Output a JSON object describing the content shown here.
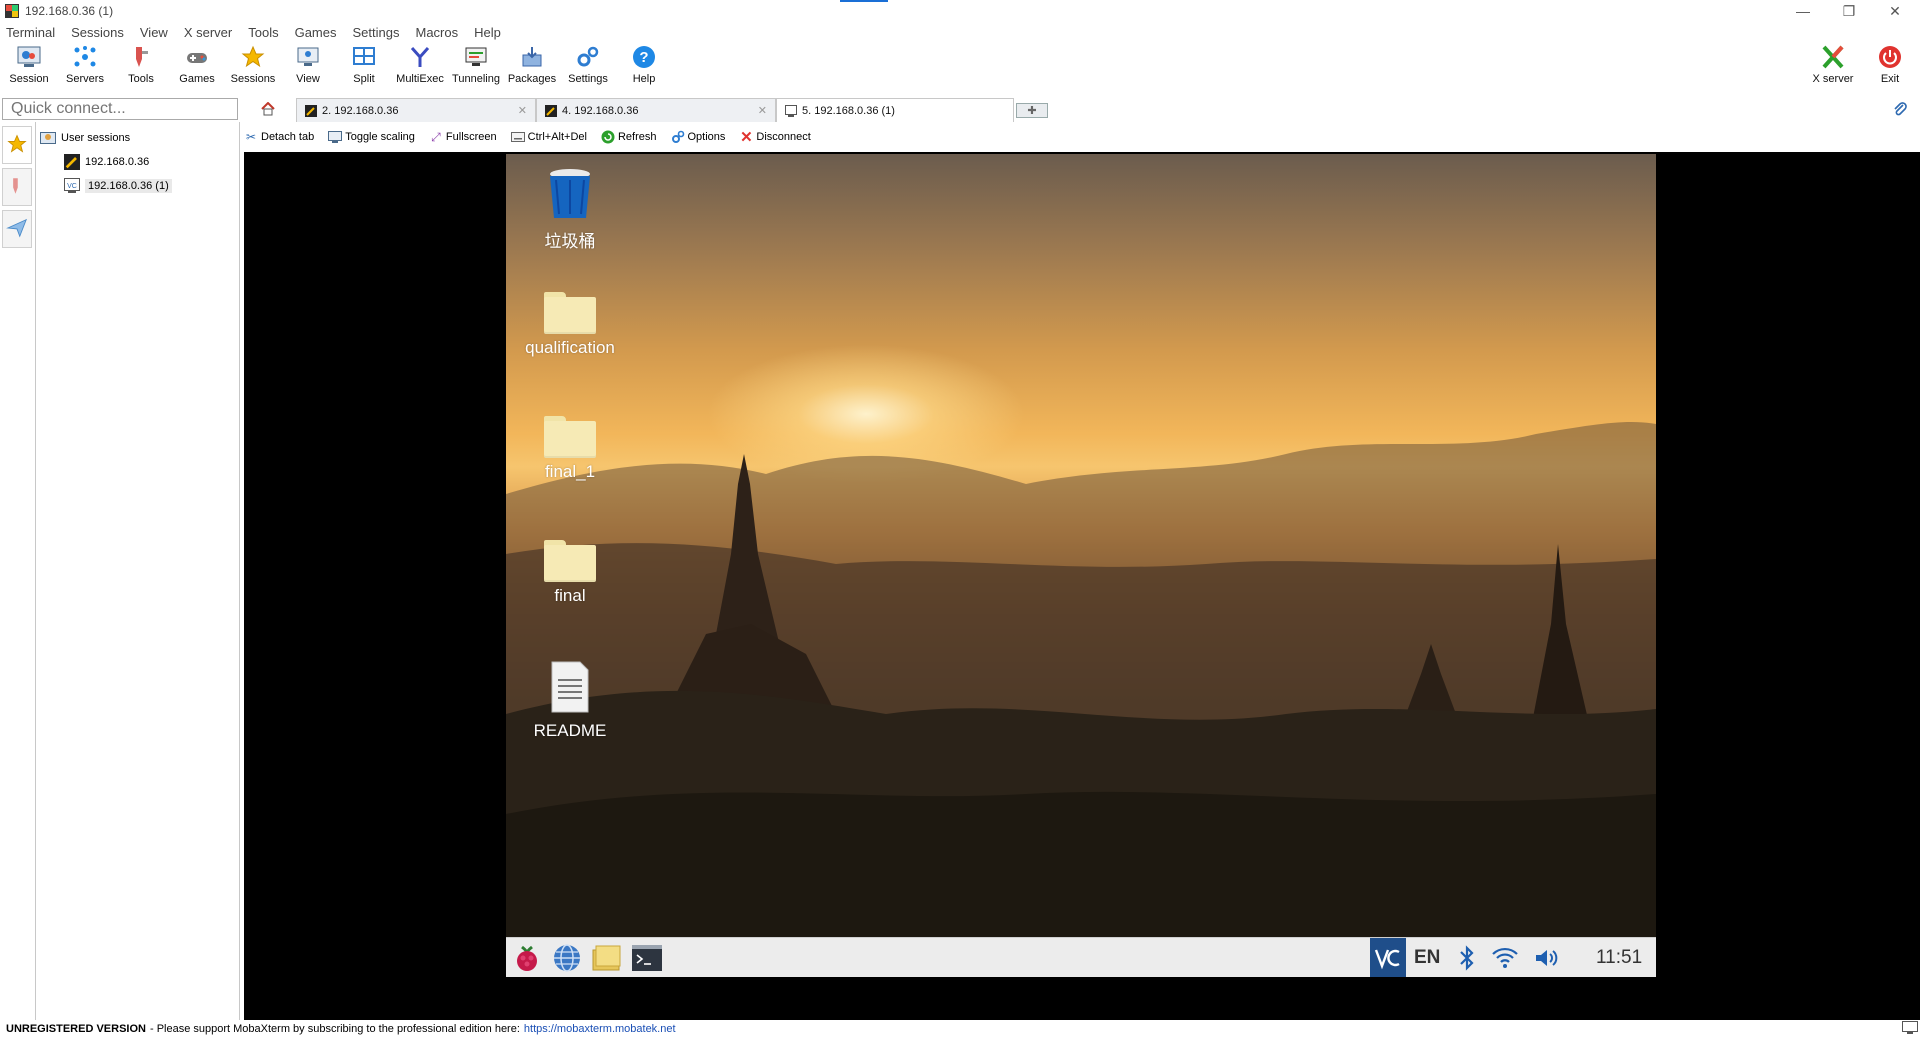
{
  "window": {
    "title": "192.168.0.36 (1)"
  },
  "menubar": [
    "Terminal",
    "Sessions",
    "View",
    "X server",
    "Tools",
    "Games",
    "Settings",
    "Macros",
    "Help"
  ],
  "toolbar": {
    "items": [
      {
        "label": "Session",
        "icon": "session-icon"
      },
      {
        "label": "Servers",
        "icon": "servers-icon"
      },
      {
        "label": "Tools",
        "icon": "tools-icon"
      },
      {
        "label": "Games",
        "icon": "games-icon"
      },
      {
        "label": "Sessions",
        "icon": "star-icon"
      },
      {
        "label": "View",
        "icon": "view-icon"
      },
      {
        "label": "Split",
        "icon": "split-icon"
      },
      {
        "label": "MultiExec",
        "icon": "multiexec-icon"
      },
      {
        "label": "Tunneling",
        "icon": "tunneling-icon"
      },
      {
        "label": "Packages",
        "icon": "packages-icon"
      },
      {
        "label": "Settings",
        "icon": "gear-icon"
      },
      {
        "label": "Help",
        "icon": "help-icon"
      }
    ],
    "xserver": "X server",
    "exit": "Exit"
  },
  "quick_connect": {
    "placeholder": "Quick connect..."
  },
  "tabs": [
    {
      "label": "2. 192.168.0.36",
      "active": false
    },
    {
      "label": "4. 192.168.0.36",
      "active": false
    },
    {
      "label": "5. 192.168.0.36 (1)",
      "active": true
    }
  ],
  "sessions": {
    "root": "User sessions",
    "items": [
      "192.168.0.36",
      "192.168.0.36 (1)"
    ]
  },
  "session_toolbar": [
    "Detach tab",
    "Toggle scaling",
    "Fullscreen",
    "Ctrl+Alt+Del",
    "Refresh",
    "Options",
    "Disconnect"
  ],
  "desktop": {
    "icons": [
      "垃圾桶",
      "qualification",
      "final_1",
      "final",
      "README"
    ],
    "tray": {
      "lang": "EN",
      "clock": "11:51"
    }
  },
  "status": {
    "unregistered": "UNREGISTERED VERSION",
    "message": "-  Please support MobaXterm by subscribing to the professional edition here:",
    "url": "https://mobaxterm.mobatek.net"
  },
  "colors": {
    "accent": "#1a6fd6",
    "exit_red": "#e0332f",
    "help_blue": "#1e88e5"
  }
}
